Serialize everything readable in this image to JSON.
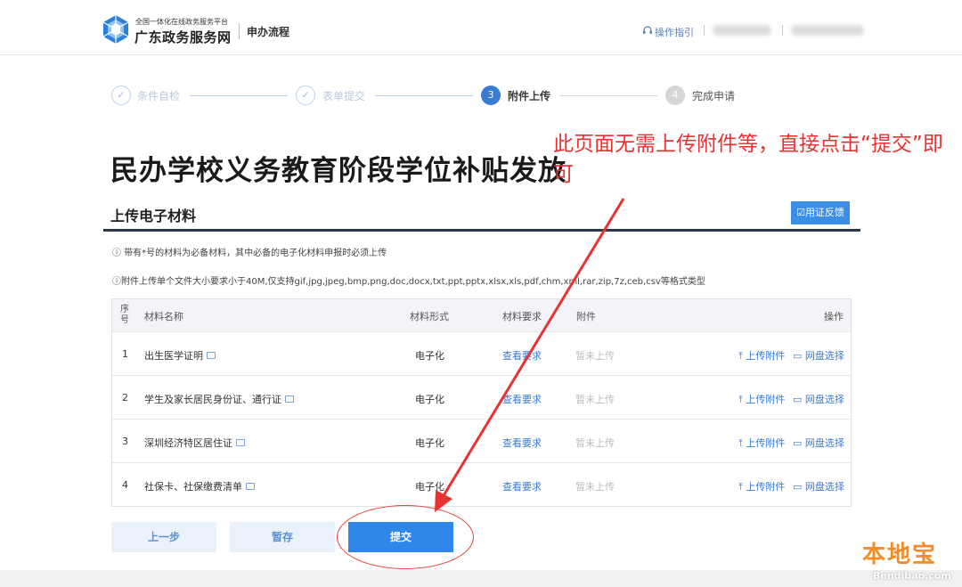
{
  "header": {
    "brand_sub": "全国一体化在线政务服务平台",
    "brand_main": "广东政务服务网",
    "page_name": "申办流程",
    "help_link": "操作指引"
  },
  "steps": [
    {
      "num": "✓",
      "label": "条件自检",
      "state": "done"
    },
    {
      "num": "✓",
      "label": "表单提交",
      "state": "done"
    },
    {
      "num": "3",
      "label": "附件上传",
      "state": "active"
    },
    {
      "num": "4",
      "label": "完成申请",
      "state": "todo"
    }
  ],
  "page_title": "民办学校义务教育阶段学位补贴发放",
  "annotation": "此页面无需上传附件等，直接点击“提交”即可",
  "section": {
    "title": "上传电子材料",
    "feedback_button": "用证反馈"
  },
  "notes": [
    "ⓘ 带有*号的材料为必备材料，其中必备的电子化材料申报时必须上传",
    "ⓘ附件上传单个文件大小要求小于40M,仅支持gif,jpg,jpeg,bmp,png,doc,docx,txt,ppt,pptx,xlsx,xls,pdf,chm,xml,rar,zip,7z,ceb,csv等格式类型"
  ],
  "table": {
    "headers": {
      "seq": "序号",
      "name": "材料名称",
      "form": "材料形式",
      "requirement": "材料要求",
      "attachment": "附件",
      "operation": "操作"
    },
    "rows": [
      {
        "seq": "1",
        "name": "出生医学证明",
        "form": "电子化",
        "requirement": "查看要求",
        "attachment": "暂未上传",
        "upload": "上传附件",
        "netdisk": "网盘选择"
      },
      {
        "seq": "2",
        "name": "学生及家长居民身份证、通行证",
        "form": "电子化",
        "requirement": "查看要求",
        "attachment": "暂未上传",
        "upload": "上传附件",
        "netdisk": "网盘选择"
      },
      {
        "seq": "3",
        "name": "深圳经济特区居住证",
        "form": "电子化",
        "requirement": "查看要求",
        "attachment": "暂未上传",
        "upload": "上传附件",
        "netdisk": "网盘选择"
      },
      {
        "seq": "4",
        "name": "社保卡、社保缴费清单",
        "form": "电子化",
        "requirement": "查看要求",
        "attachment": "暂未上传",
        "upload": "上传附件",
        "netdisk": "网盘选择"
      }
    ]
  },
  "buttons": {
    "prev": "上一步",
    "save": "暂存",
    "submit": "提交"
  },
  "watermark": {
    "logo": "本地宝",
    "url": "Bendibao.com"
  },
  "colors": {
    "accent": "#3a7bd5",
    "annotation": "#e83232",
    "primary_button": "#2f87e8"
  }
}
